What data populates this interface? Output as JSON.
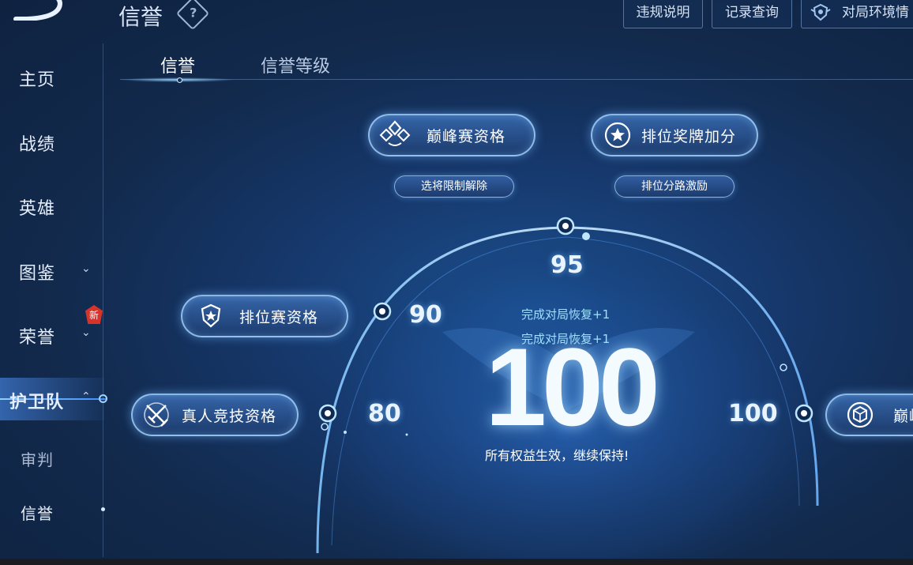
{
  "header": {
    "title": "信誉",
    "help_symbol": "?"
  },
  "top_buttons": {
    "violation": "违规说明",
    "records": "记录查询",
    "environment": "对局环境情"
  },
  "sidebar": {
    "items": [
      {
        "label": "主页"
      },
      {
        "label": "战绩"
      },
      {
        "label": "英雄"
      },
      {
        "label": "图鉴"
      },
      {
        "label": "荣誉",
        "badge": "新"
      },
      {
        "label": "护卫队"
      },
      {
        "label": "审判"
      },
      {
        "label": "信誉"
      }
    ]
  },
  "tabs": [
    {
      "label": "信誉"
    },
    {
      "label": "信誉等级"
    }
  ],
  "benefits": {
    "peak_match": "巅峰赛资格",
    "rank_medal": "排位奖牌加分",
    "hero_limit": "选将限制解除",
    "lane_bonus": "排位分路激励",
    "ranked_match": "排位赛资格",
    "real_match": "真人竞技资格",
    "right_partial": "巅峰"
  },
  "thresholds": {
    "t80": "80",
    "t90": "90",
    "t95": "95",
    "t100": "100"
  },
  "restore_lines": [
    "完成对局恢复+1",
    "完成对局恢复+1"
  ],
  "credit": {
    "score": "100",
    "status": "所有权益生效，继续保持!"
  },
  "colors": {
    "accent": "#9fd4ff",
    "badge": "#d7332a",
    "background": "#16376a"
  }
}
